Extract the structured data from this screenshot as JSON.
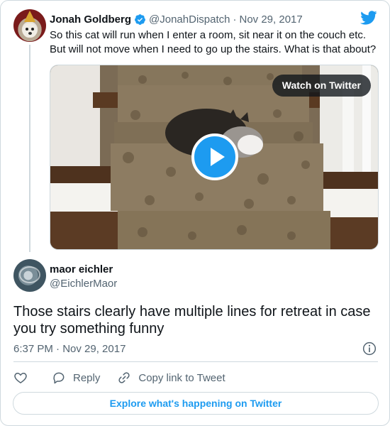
{
  "parent_tweet": {
    "author_name": "Jonah Goldberg",
    "handle": "@JonahDispatch",
    "separator": "·",
    "date": "Nov 29, 2017",
    "text": "So this cat will run when I enter a room, sit near it on the couch etc. But will not move when I need to go up the stairs. What is that about?",
    "media": {
      "watch_label": "Watch on Twitter",
      "play_icon": "play-icon"
    }
  },
  "reply_tweet": {
    "author_name": "maor eichler",
    "handle": "@EichlerMaor",
    "text": "Those stairs clearly have multiple lines for retreat in case you try something funny",
    "timestamp": "6:37 PM · Nov 29, 2017"
  },
  "actions": {
    "like_icon": "heart-icon",
    "reply_label": "Reply",
    "copy_link_label": "Copy link to Tweet"
  },
  "footer": {
    "explore_label": "Explore what's happening on Twitter"
  },
  "colors": {
    "accent": "#1d9bf0",
    "text_primary": "#0f1419",
    "text_secondary": "#536471",
    "border": "#cfd9de"
  }
}
